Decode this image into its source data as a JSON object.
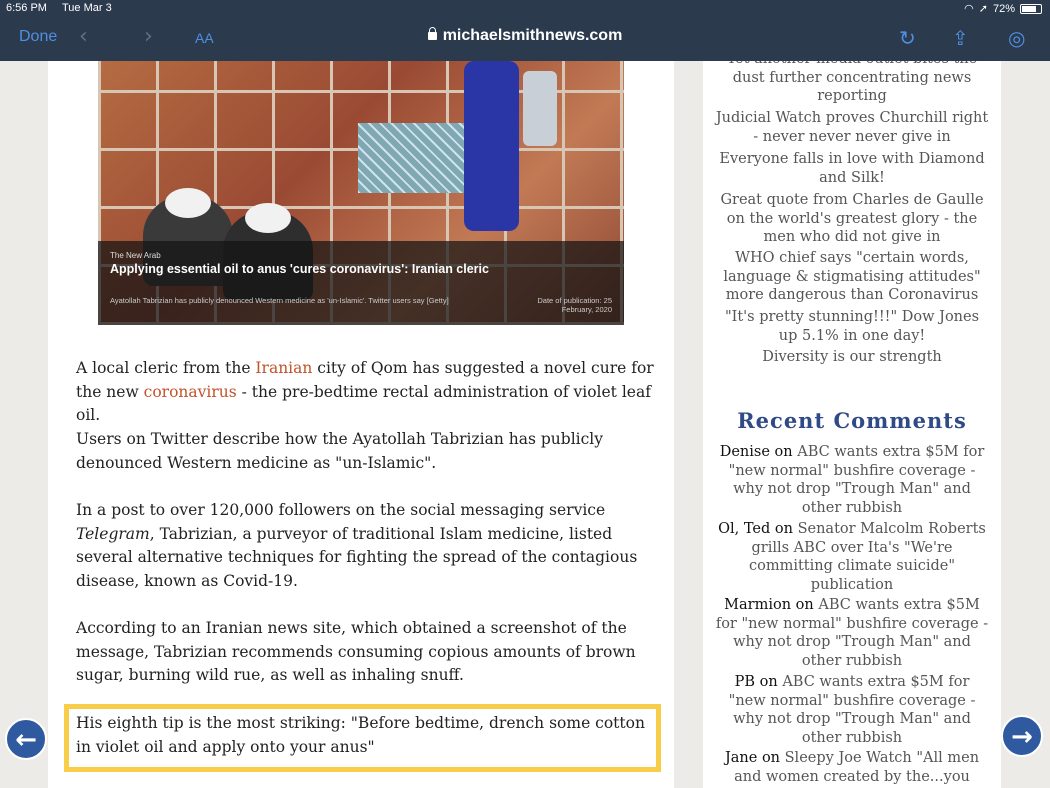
{
  "status": {
    "time": "6:56 PM",
    "date": "Tue Mar 3",
    "battery": "72%"
  },
  "nav": {
    "done": "Done",
    "text_size": "AA",
    "url": "michaelsmithnews.com"
  },
  "hero": {
    "source": "The New Arab",
    "title": "Applying essential oil to anus 'cures coronavirus': Iranian cleric",
    "caption": "Ayatollah Tabrizian has publicly denounced Western medicine as 'un-Islamic'. Twitter users say [Getty]",
    "date": "Date of publication: 25 February, 2020"
  },
  "article": {
    "p1_a": "A local cleric from the ",
    "p1_link1": "Iranian",
    "p1_b": " city of Qom has suggested a novel cure for the new ",
    "p1_link2": "coronavirus",
    "p1_c": " - the pre-bedtime rectal administration of violet leaf oil.",
    "p2": "Users on Twitter describe how the Ayatollah Tabrizian has publicly denounced Western medicine as \"un-Islamic\".",
    "p3_a": "In a post to over 120,000 followers on the social messaging service ",
    "p3_em": "Telegram",
    "p3_b": ", Tabrizian, a purveyor of traditional Islam medicine, listed several alternative techniques for fighting the spread of the contagious disease, known as Covid-19.",
    "p4": "According to an Iranian news site, which obtained a screenshot of the message, Tabrizian recommends consuming copious amounts of brown sugar, burning wild rue, as well as inhaling snuff.",
    "p5": "His eighth tip is the most striking: \"Before bedtime, drench some cotton in violet oil and apply onto your anus\""
  },
  "sidebar": {
    "posts": [
      "Yet another media outlet bites the dust further concentrating news reporting",
      "Judicial Watch proves Churchill right - never never never give in",
      "Everyone falls in love with Diamond and Silk!",
      "Great quote from Charles de Gaulle on the world's greatest glory - the men who did not give in",
      "WHO chief says \"certain words, language & stigmatising attitudes\" more dangerous than Coronavirus",
      "\"It's pretty stunning!!!\" Dow Jones up 5.1% in one day!",
      "Diversity is our strength"
    ],
    "recent_title": "Recent Comments",
    "on": "on",
    "comments": [
      {
        "author": "Denise",
        "post": "ABC wants extra $5M for \"new normal\" bushfire coverage - why not drop \"Trough Man\" and other rubbish"
      },
      {
        "author": "Ol, Ted",
        "post": "Senator Malcolm Roberts grills ABC over Ita's \"We're committing climate suicide\" publication"
      },
      {
        "author": "Marmion",
        "post": "ABC wants extra $5M for \"new normal\" bushfire coverage - why not drop \"Trough Man\" and other rubbish"
      },
      {
        "author": "PB",
        "post": "ABC wants extra $5M for \"new normal\" bushfire coverage - why not drop \"Trough Man\" and other rubbish"
      },
      {
        "author": "Jane",
        "post": "Sleepy Joe Watch \"All men and women created by the...you"
      }
    ]
  },
  "icons": {
    "prev": "arrow-left-icon",
    "next": "arrow-right-icon"
  }
}
